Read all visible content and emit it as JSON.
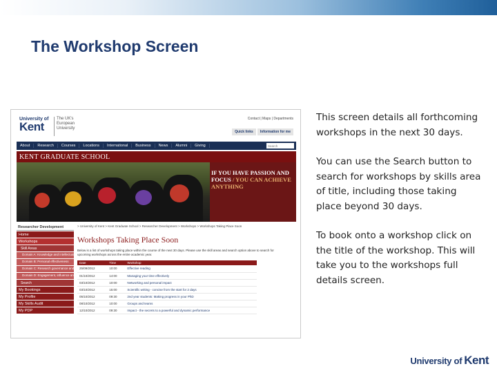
{
  "slide": {
    "title": "The Workshop Screen",
    "paragraphs": [
      "This screen details all forthcoming workshops in the next 30 days.",
      "You can use the Search button to search for workshops by skills area of title, including those taking place beyond 30 days.",
      "To book onto a workshop click on the title of the workshop. This will take you to the workshops full details screen."
    ],
    "footer_logo": {
      "part1": "University of",
      "part2": "Kent"
    }
  },
  "site": {
    "logo": {
      "top": "University of",
      "main": "Kent",
      "tagline": "The UK's European University"
    },
    "toplinks": "Contact | Maps | Departments",
    "quicklinks": [
      "Quick links",
      "Information for me"
    ],
    "nav": [
      "About",
      "Research",
      "Courses",
      "Locations",
      "International",
      "Business",
      "News",
      "Alumni",
      "Giving"
    ],
    "search_placeholder": "Search",
    "banner": {
      "heading": "KENT GRADUATE SCHOOL",
      "slogan_line1": "IF YOU HAVE PASSION AND FOCUS",
      "slogan_line2": " / YOU CAN ACHIEVE ANYTHING"
    },
    "sidebar": {
      "heading": "Researcher Development",
      "items": [
        "Home",
        "Workshops"
      ],
      "skill_areas_label": "Skill Areas",
      "subitems": [
        "Domain A: Knowledge and intellectual abilities",
        "Domain B: Personal effectiveness",
        "Domain C: Research governance and organisation",
        "Domain D: Engagement, influence and impact"
      ],
      "search_label": "Search",
      "more_items": [
        "My Bookings",
        "My Profile",
        "My Skills Audit",
        "My PDP"
      ]
    },
    "breadcrumb": "> University of Kent  > Kent Graduate School  > Researcher Development  > Workshops  > Workshops Taking Place Soon",
    "page_heading": "Workshops Taking Place Soon",
    "intro": "Below is a list of workshops taking place within the course of the next 30 days. Please use the skill areas and search option above to search for upcoming workshops across the entire academic year.",
    "table": {
      "headers": [
        "Date",
        "Time",
        "Workshop"
      ],
      "rows": [
        [
          "25/09/2012",
          "10:00",
          "Effective reading"
        ],
        [
          "01/10/2012",
          "14:00",
          "Managing your time effectively"
        ],
        [
          "03/10/2012",
          "10:00",
          "Networking and personal impact"
        ],
        [
          "03/10/2012",
          "15:00",
          "Scientific writing - concise from the start for 2 days"
        ],
        [
          "05/10/2012",
          "09:30",
          "2nd year students: Making progress in your PhD"
        ],
        [
          "08/10/2012",
          "10:00",
          "Groups and teams"
        ],
        [
          "12/10/2012",
          "09:30",
          "Impact - the secrets to a powerful and dynamic performance"
        ]
      ]
    }
  }
}
